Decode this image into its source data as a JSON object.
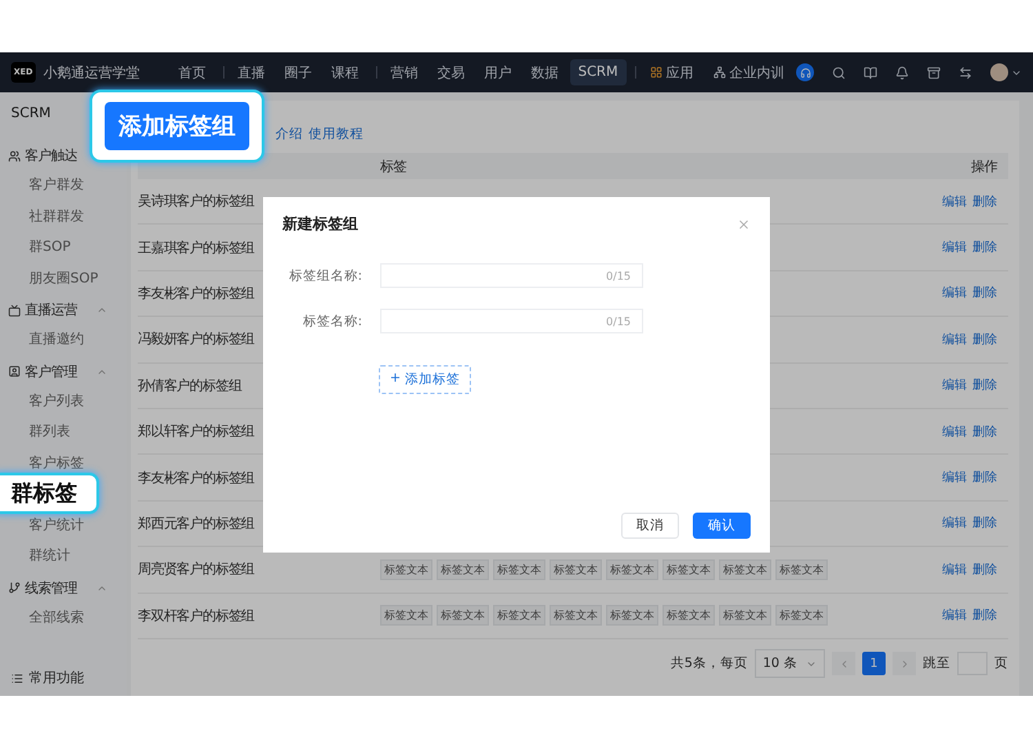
{
  "nav": {
    "logo": "XED",
    "brand": "小鹅通运营学堂",
    "groups": [
      {
        "items": [
          {
            "label": "首页",
            "selected": false,
            "kind": "plain"
          }
        ]
      },
      {
        "items": [
          {
            "label": "直播",
            "selected": false,
            "kind": "plain"
          },
          {
            "label": "圈子",
            "selected": false,
            "kind": "plain"
          },
          {
            "label": "课程",
            "selected": false,
            "kind": "plain"
          }
        ]
      },
      {
        "items": [
          {
            "label": "营销",
            "selected": false,
            "kind": "plain"
          },
          {
            "label": "交易",
            "selected": false,
            "kind": "plain"
          },
          {
            "label": "用户",
            "selected": false,
            "kind": "plain"
          },
          {
            "label": "数据",
            "selected": false,
            "kind": "plain"
          },
          {
            "label": "SCRM",
            "selected": true,
            "kind": "plain"
          }
        ]
      },
      {
        "items": [
          {
            "label": "应用",
            "selected": false,
            "kind": "apps"
          },
          {
            "label": "企业内训",
            "selected": false,
            "kind": "org"
          }
        ]
      }
    ]
  },
  "sidebar": {
    "title": "SCRM",
    "groups": [
      {
        "label": "客户触达",
        "kind": "reach",
        "expanded": true,
        "children": [
          {
            "label": "客户群发",
            "highlighted": false
          },
          {
            "label": "社群群发",
            "highlighted": false
          },
          {
            "label": "群SOP",
            "highlighted": false
          },
          {
            "label": "朋友圈SOP",
            "highlighted": false
          }
        ]
      },
      {
        "label": "直播运营",
        "kind": "live",
        "expanded": true,
        "children": [
          {
            "label": "直播邀约",
            "highlighted": false
          }
        ]
      },
      {
        "label": "客户管理",
        "kind": "customer",
        "expanded": true,
        "children": [
          {
            "label": "客户列表",
            "highlighted": false
          },
          {
            "label": "群列表",
            "highlighted": false
          },
          {
            "label": "客户标签",
            "highlighted": false
          },
          {
            "label": "群标签",
            "highlighted": true
          },
          {
            "label": "客户统计",
            "highlighted": false
          },
          {
            "label": "群统计",
            "highlighted": false
          }
        ]
      },
      {
        "label": "线索管理",
        "kind": "leads",
        "expanded": true,
        "children": [
          {
            "label": "全部线索",
            "highlighted": false
          }
        ]
      }
    ],
    "footer": "常用功能"
  },
  "toolbar": {
    "add_button": {
      "label": "添加标签组",
      "highlighted": true
    },
    "links": [
      "介绍",
      "使用教程"
    ]
  },
  "table": {
    "columns": [
      "标签",
      "操作"
    ],
    "rows": [
      {
        "name": "吴诗琪客户的标签组",
        "actions": [
          "编辑",
          "删除"
        ]
      },
      {
        "name": "王嘉琪客户的标签组",
        "actions": [
          "编辑",
          "删除"
        ]
      },
      {
        "name": "李友彬客户的标签组",
        "actions": [
          "编辑",
          "删除"
        ]
      },
      {
        "name": "冯毅妍客户的标签组",
        "actions": [
          "编辑",
          "删除"
        ]
      },
      {
        "name": "孙倩客户的标签组",
        "actions": [
          "编辑",
          "删除"
        ]
      },
      {
        "name": "郑以轩客户的标签组",
        "actions": [
          "编辑",
          "删除"
        ]
      },
      {
        "name": "李友彬客户的标签组",
        "actions": [
          "编辑",
          "删除"
        ]
      },
      {
        "name": "郑西元客户的标签组",
        "actions": [
          "编辑",
          "删除"
        ]
      },
      {
        "name": "周亮贤客户的标签组",
        "tags": [
          "标签文本",
          "标签文本",
          "标签文本",
          "标签文本",
          "标签文本",
          "标签文本",
          "标签文本",
          "标签文本"
        ],
        "actions": [
          "编辑",
          "删除"
        ]
      },
      {
        "name": "李双杆客户的标签组",
        "tags": [
          "标签文本",
          "标签文本",
          "标签文本",
          "标签文本",
          "标签文本",
          "标签文本",
          "标签文本",
          "标签文本"
        ],
        "actions": [
          "编辑",
          "删除"
        ]
      }
    ]
  },
  "pagination": {
    "total": "共5条，每页",
    "page_size": "10 条",
    "pages": [
      {
        "label": "1",
        "selected": true
      }
    ],
    "jump_label": "跳至",
    "jump_suffix": "页"
  },
  "dialog": {
    "title": "新建标签组",
    "fields": [
      {
        "label": "标签组名称:",
        "counter": "0/15"
      },
      {
        "label": "标签名称:",
        "counter": "0/15"
      }
    ],
    "add_tag": "添加标签",
    "add_tag_icon": "+",
    "cancel": "取消",
    "confirm": "确认"
  }
}
